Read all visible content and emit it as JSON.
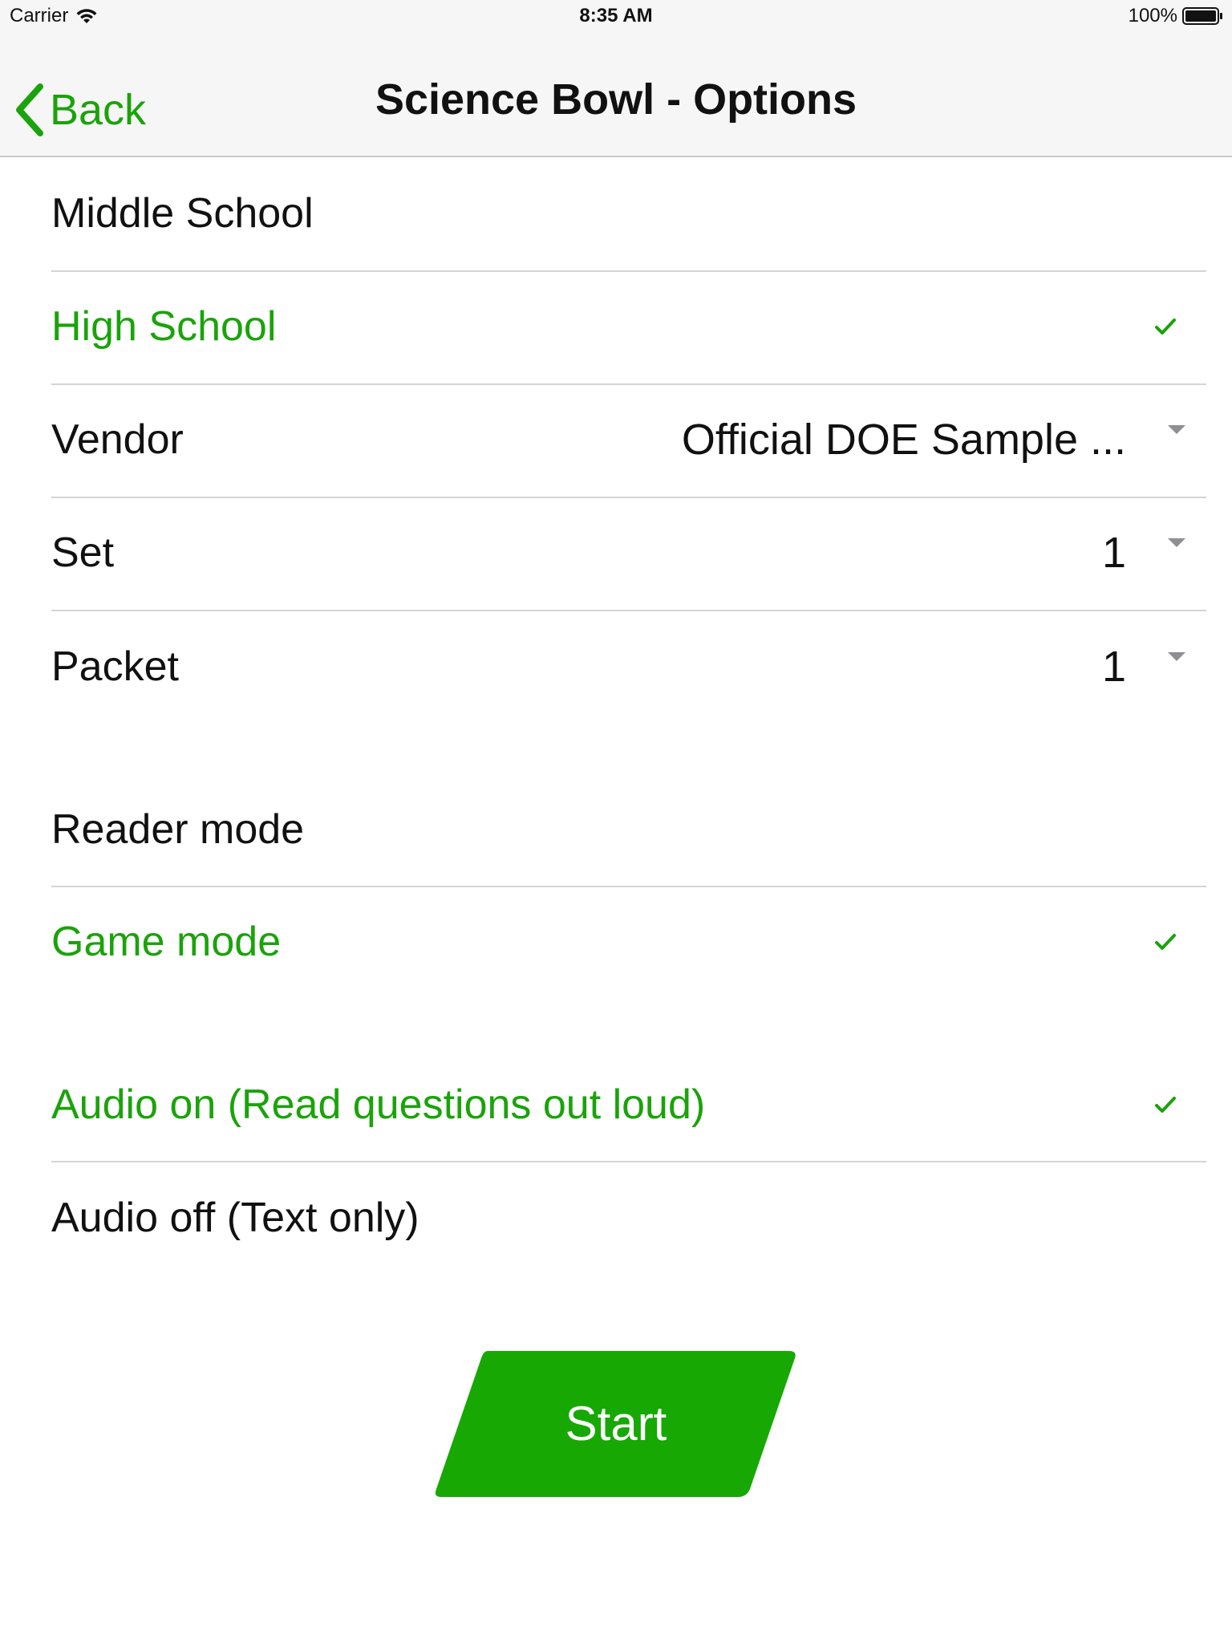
{
  "status_bar": {
    "carrier": "Carrier",
    "time": "8:35 AM",
    "battery": "100%",
    "wifi_icon": "wifi-icon",
    "battery_icon": "battery-full-icon"
  },
  "nav": {
    "back_label": "Back",
    "back_icon": "chevron-left-icon",
    "title": "Science Bowl - Options"
  },
  "level": {
    "options": [
      {
        "label": "Middle School",
        "selected": false
      },
      {
        "label": "High School",
        "selected": true
      }
    ]
  },
  "filters": {
    "vendor": {
      "label": "Vendor",
      "value": "Official DOE Sample ..."
    },
    "set": {
      "label": "Set",
      "value": "1"
    },
    "packet": {
      "label": "Packet",
      "value": "1"
    }
  },
  "mode": {
    "options": [
      {
        "label": "Reader mode",
        "selected": false
      },
      {
        "label": "Game mode",
        "selected": true
      }
    ]
  },
  "audio": {
    "options": [
      {
        "label": "Audio on (Read questions out loud)",
        "selected": true
      },
      {
        "label": "Audio off (Text only)",
        "selected": false
      }
    ]
  },
  "start_button": {
    "label": "Start"
  },
  "colors": {
    "accent": "#1aa30a",
    "start_button": "#17a803",
    "separator": "#d4d4d8",
    "nav_background": "#f6f6f6",
    "caret": "#8e8e93"
  }
}
